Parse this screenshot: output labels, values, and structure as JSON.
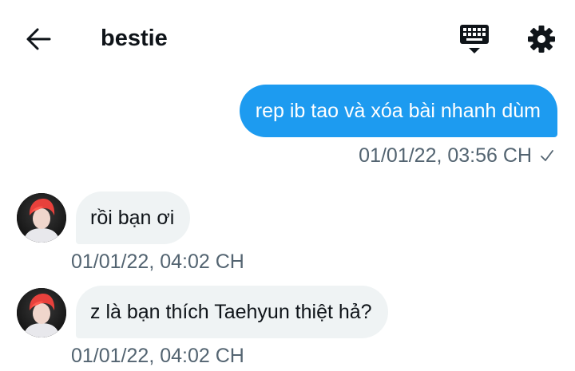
{
  "header": {
    "title": "bestie",
    "back_icon": "arrow-left-icon",
    "keyboard_icon": "keyboard-icon",
    "settings_icon": "gear-icon"
  },
  "messages": [
    {
      "direction": "outgoing",
      "text": "rep ib tao và xóa bài nhanh dùm",
      "timestamp": "01/01/22, 03:56 CH",
      "status_icon": "check-icon"
    },
    {
      "direction": "incoming",
      "text": "rồi bạn ơi",
      "timestamp": "01/01/22, 04:02 CH",
      "avatar": "avatar-icon"
    },
    {
      "direction": "incoming",
      "text": "z là bạn thích Taehyun thiệt hả?",
      "timestamp": "01/01/22, 04:02 CH",
      "avatar": "avatar-icon"
    }
  ],
  "colors": {
    "accent": "#1d9bf0",
    "incoming_bubble": "#eff3f4",
    "meta_text": "#536471",
    "text": "#0f1419"
  }
}
